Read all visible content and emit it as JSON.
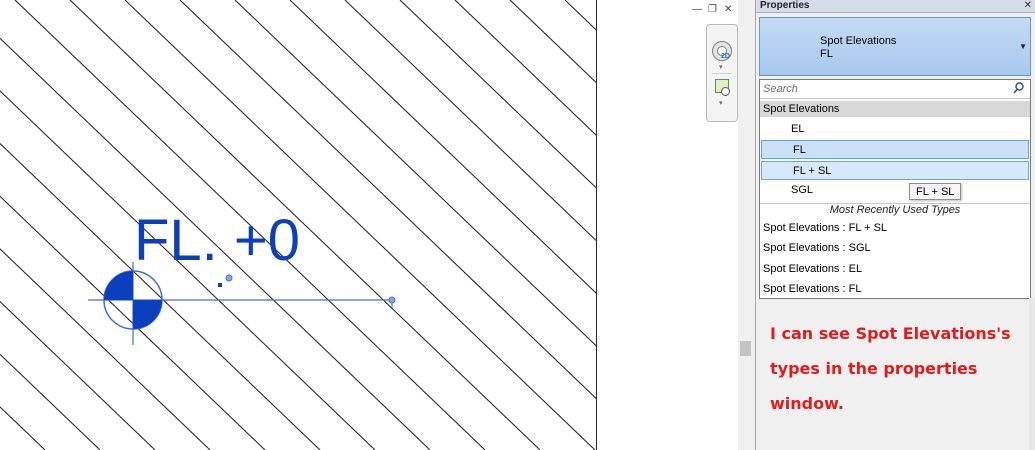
{
  "canvas": {
    "spot_elevation_text": "FL. +0",
    "colors": {
      "annotation_blue": "#0b3fbd",
      "hatch": "#1a1a1a"
    }
  },
  "view_controls": {
    "minimize_glyph": "—",
    "restore_glyph": "❐",
    "close_glyph": "✕",
    "nav_wheel_label": "2D",
    "nav_arrow": "▾"
  },
  "properties": {
    "title": "Properties",
    "close_glyph": "✕",
    "type_selector": {
      "family": "Spot Elevations",
      "type": "FL",
      "dropdown_arrow": "▼"
    },
    "search": {
      "placeholder": "Search",
      "value": ""
    },
    "group_header": "Spot Elevations",
    "types": [
      {
        "label": "EL",
        "state": "normal"
      },
      {
        "label": "FL",
        "state": "selected"
      },
      {
        "label": "FL + SL",
        "state": "hover"
      },
      {
        "label": "SGL",
        "state": "normal"
      }
    ],
    "mru_header": "Most Recently Used Types",
    "mru_items": [
      "Spot Elevations : FL + SL",
      "Spot Elevations : SGL",
      "Spot Elevations : EL",
      "Spot Elevations : FL"
    ],
    "tooltip": "FL + SL"
  },
  "annotation": {
    "text": "I can see Spot Elevations's types in the properties window.",
    "color": "#e01c1c"
  }
}
